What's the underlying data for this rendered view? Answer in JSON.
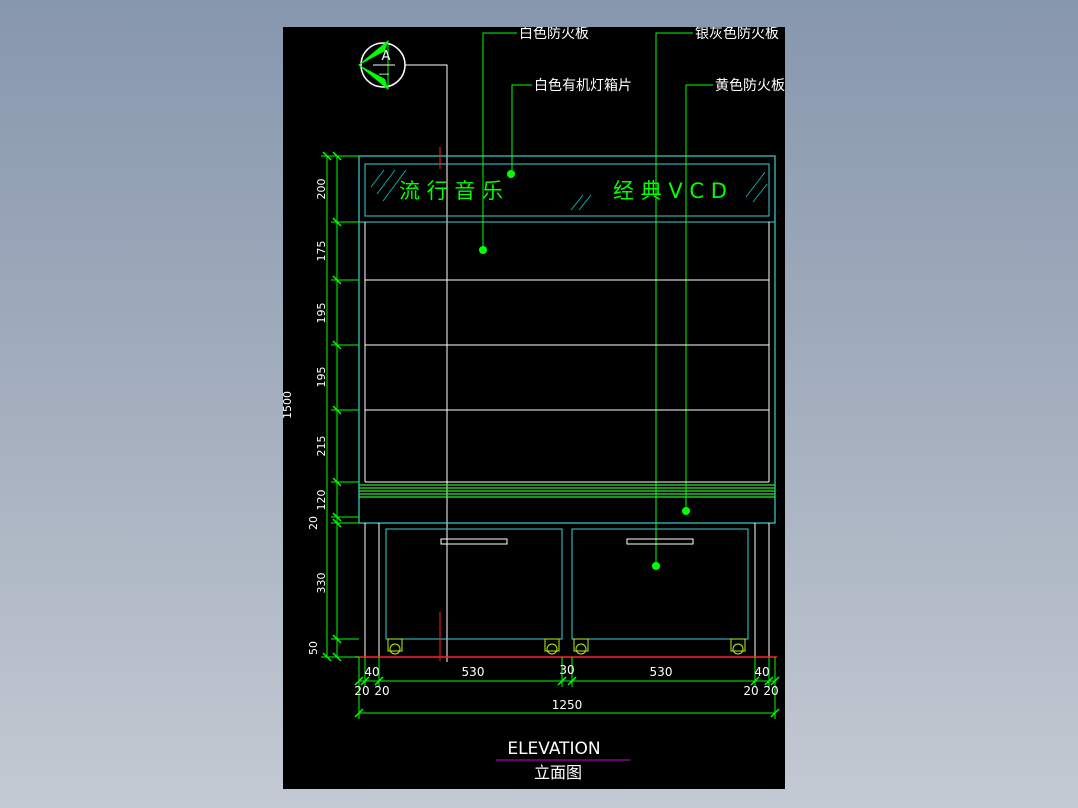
{
  "colors": {
    "cyan": "#39d0d6",
    "green": "#00ff00",
    "white": "#ffffff",
    "red": "#ff2020",
    "magenta": "#d000d0",
    "yellowgreen": "#b6f018"
  },
  "section_marker": {
    "letter": "A",
    "sub": "—"
  },
  "labels": {
    "white_fireproof_board": "白色防火板",
    "silver_fireproof_board": "银灰色防火板",
    "white_lightbox_sheet": "白色有机灯箱片",
    "yellow_fireproof_board": "黄色防火板"
  },
  "sign": {
    "left_text": "流 行 音 乐",
    "right_text": "经 典 V C D"
  },
  "dims_vertical": [
    "200",
    "175",
    "195",
    "195",
    "215",
    "120",
    "20",
    "330",
    "50"
  ],
  "dim_total_height": "1500",
  "dims_horizontal_top": [
    "40",
    "530",
    "30",
    "530",
    "40"
  ],
  "dims_horizontal_small": [
    "20",
    "20",
    "20",
    "20"
  ],
  "dim_total_width": "1250",
  "title": "ELEVATION",
  "subtitle": "立面图"
}
